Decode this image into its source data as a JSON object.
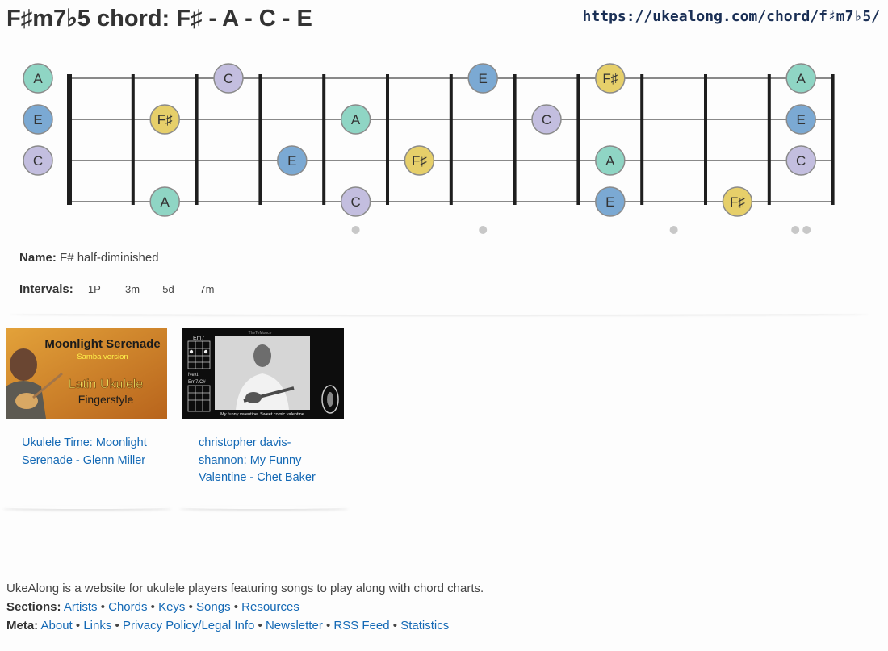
{
  "page": {
    "title": "F♯m7♭5 chord: F♯ - A - C - E",
    "url": "https://ukealong.com/chord/f♯m7♭5/"
  },
  "colors": {
    "A": "#8fd5c4",
    "E": "#7ba9d3",
    "C": "#c3bedf",
    "F♯": "#e6cf6a"
  },
  "fretboard": {
    "strings": [
      {
        "open": "A",
        "notes": [
          {
            "fret": 3,
            "note": "C"
          },
          {
            "fret": 7,
            "note": "E"
          },
          {
            "fret": 9,
            "note": "F♯"
          },
          {
            "fret": 12,
            "note": "A"
          }
        ]
      },
      {
        "open": "E",
        "notes": [
          {
            "fret": 2,
            "note": "F♯"
          },
          {
            "fret": 5,
            "note": "A"
          },
          {
            "fret": 8,
            "note": "C"
          },
          {
            "fret": 12,
            "note": "E"
          }
        ]
      },
      {
        "open": "C",
        "notes": [
          {
            "fret": 4,
            "note": "E"
          },
          {
            "fret": 6,
            "note": "F♯"
          },
          {
            "fret": 9,
            "note": "A"
          },
          {
            "fret": 12,
            "note": "C"
          }
        ]
      },
      {
        "open": "",
        "notes": [
          {
            "fret": 2,
            "note": "A"
          },
          {
            "fret": 5,
            "note": "C"
          },
          {
            "fret": 9,
            "note": "E"
          },
          {
            "fret": 11,
            "note": "F♯"
          }
        ]
      }
    ],
    "fret_markers": [
      5,
      7,
      10,
      12
    ]
  },
  "info": {
    "name_label": "Name:",
    "name_value": "F# half-diminished",
    "intervals_label": "Intervals:",
    "intervals": [
      "1P",
      "3m",
      "5d",
      "7m"
    ]
  },
  "videos": [
    {
      "title": "Ukulele Time: Moonlight Serenade - Glenn Miller",
      "thumb_title": "Moonlight Serenade",
      "thumb_sub": "Samba version",
      "thumb_line1": "Latin Ukulele",
      "thumb_line2": "Fingerstyle"
    },
    {
      "title": "christopher davis-shannon: My Funny Valentine - Chet Baker",
      "thumb_header": "TheTeMonce",
      "thumb_chord1": "Em7",
      "thumb_next": "Next:",
      "thumb_chord2": "Em7/C#",
      "thumb_caption": "My funny valentine. Sweet comic valentine"
    }
  ],
  "footer": {
    "description": "UkeAlong is a website for ukulele players featuring songs to play along with chord charts.",
    "sections_label": "Sections:",
    "sections": [
      "Artists",
      "Chords",
      "Keys",
      "Songs",
      "Resources"
    ],
    "meta_label": "Meta:",
    "meta": [
      "About",
      "Links",
      "Privacy Policy/Legal Info",
      "Newsletter",
      "RSS Feed",
      "Statistics"
    ]
  }
}
